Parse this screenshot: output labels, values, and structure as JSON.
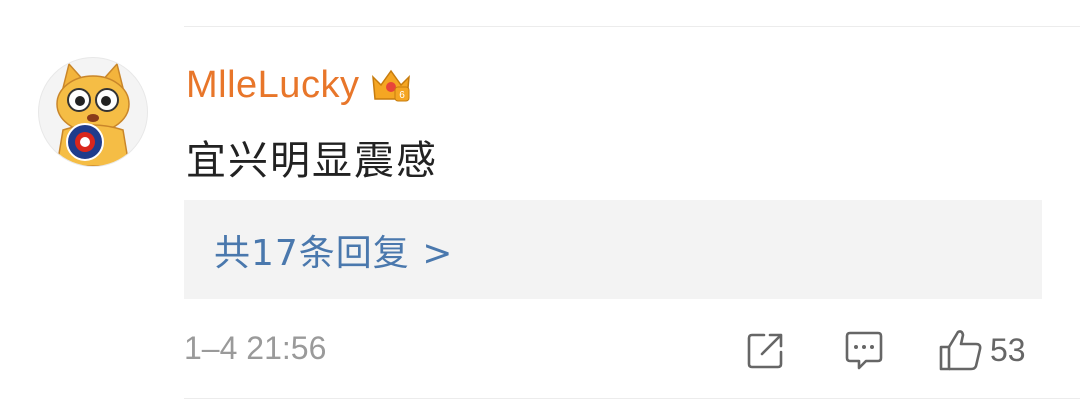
{
  "comment": {
    "username": "MlleLucky",
    "text": "宜兴明显震感",
    "replies_label": "共17条回复 >",
    "timestamp": "1–4 21:56",
    "like_count": "53",
    "colors": {
      "username": "#e8762a",
      "reply_link": "#4a78ad",
      "reply_bg": "#f3f3f3"
    },
    "icons": {
      "avatar": "cartoon-cat-avatar",
      "badge": "vip-crown-badge",
      "share": "share-icon",
      "comment": "comment-icon",
      "like": "thumbs-up-icon"
    }
  }
}
